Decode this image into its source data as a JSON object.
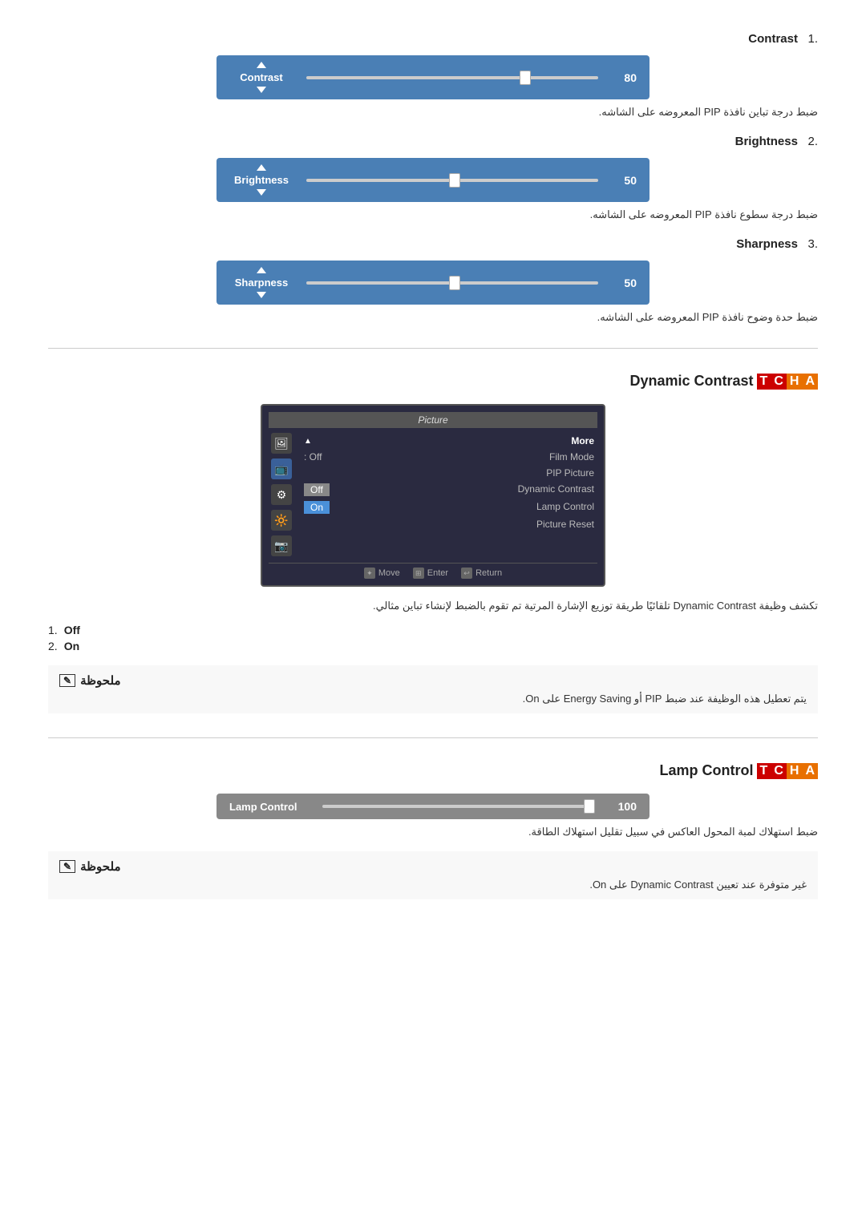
{
  "contrast": {
    "heading_number": "1.",
    "heading_label": "Contrast",
    "label": "Contrast",
    "value": "80",
    "thumb_percent": 75,
    "description": "ضبط درجة تباين نافذة PIP المعروضه على الشاشه."
  },
  "brightness": {
    "heading_number": "2.",
    "heading_label": "Brightness",
    "label": "Brightness",
    "value": "50",
    "thumb_percent": 50,
    "description": "ضبط درجة سطوع نافذة PIP المعروضه على الشاشه."
  },
  "sharpness": {
    "heading_number": "3.",
    "heading_label": "Sharpness",
    "label": "Sharpness",
    "value": "50",
    "thumb_percent": 50,
    "description": "ضبط حدة وضوح نافذة PIP المعروضه على الشاشه."
  },
  "dynamic_contrast": {
    "tcha": "TCHA",
    "title": "Dynamic Contrast",
    "osd": {
      "title": "Picture",
      "menu_items": [
        {
          "label": "▲ More",
          "val": "",
          "type": "more"
        },
        {
          "label": "Film Mode",
          "val": ": Off",
          "type": "normal"
        },
        {
          "label": "PIP Picture",
          "val": "",
          "type": "normal"
        },
        {
          "label": "Dynamic Contrast",
          "val": ": Off",
          "type": "highlighted-off"
        },
        {
          "label": "Lamp Control",
          "val": ": On",
          "type": "highlighted-on"
        },
        {
          "label": "Picture Reset",
          "val": "",
          "type": "normal"
        }
      ],
      "footer": [
        "Move",
        "Enter",
        "Return"
      ]
    },
    "description": "تكشف وظيفة Dynamic Contrast تلقائيًا طريقة توزيع الإشارة المرتية تم تقوم بالضبط لإنشاء تباين مثالي.",
    "options": [
      {
        "number": "1.",
        "label": "Off"
      },
      {
        "number": "2.",
        "label": "On"
      }
    ],
    "note_title": "ملحوظة",
    "note_text": "يتم تعطيل هذه الوظيفة عند ضبط PIP أو Energy Saving على On."
  },
  "lamp_control": {
    "tcha": "TCHA",
    "title": "Lamp Control",
    "label": "Lamp Control",
    "value": "100",
    "thumb_percent": 100,
    "description": "ضبط استهلاك لمبة المحول العاكس في سبيل تقليل استهلاك الطاقة.",
    "note_title": "ملحوظة",
    "note_text": "غير متوفرة عند تعيين Dynamic Contrast على On."
  },
  "icons": {
    "contrast_up": "▲",
    "contrast_down": "▼",
    "note_pencil": "✎",
    "osd_icon1": "🖼",
    "osd_icon2": "📺",
    "osd_icon3": "⚙",
    "osd_icon4": "🔆",
    "osd_icon5": "📷"
  }
}
